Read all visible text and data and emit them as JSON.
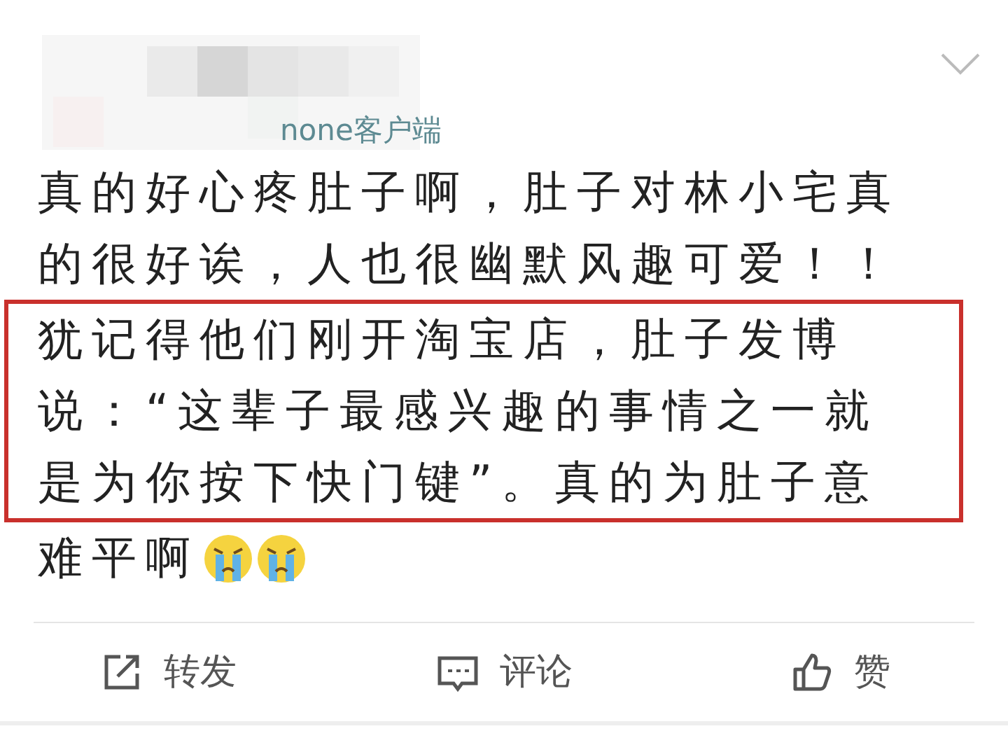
{
  "post": {
    "source": "none客户端",
    "lines": [
      {
        "text": "真的好心疼肚子啊，肚子对林小宅真",
        "highlighted": false
      },
      {
        "text": "的很好诶，人也很幽默风趣可爱！！",
        "highlighted": false
      },
      {
        "text": "犹记得他们刚开淘宝店，肚子发博",
        "highlighted": true
      },
      {
        "text": "说：“这辈子最感兴趣的事情之一就",
        "highlighted": true
      },
      {
        "text": "是为你按下快门键”。真的为肚子意",
        "highlighted": true
      },
      {
        "text": "难平啊",
        "highlighted": false
      }
    ],
    "emojis": [
      {
        "kind": "crying"
      },
      {
        "kind": "crying"
      }
    ]
  },
  "actions": [
    {
      "kind": "repost",
      "label": "转发"
    },
    {
      "kind": "comment",
      "label": "评论"
    },
    {
      "kind": "like",
      "label": "赞"
    }
  ]
}
